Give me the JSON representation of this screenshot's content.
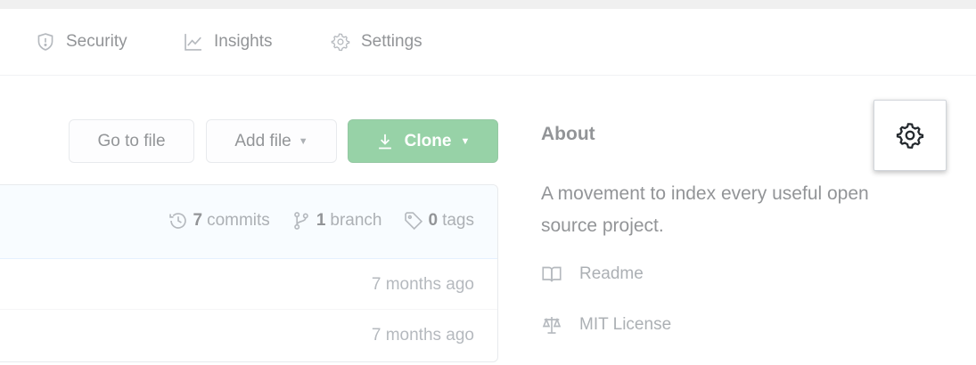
{
  "nav": {
    "tabs": [
      {
        "label": "Security",
        "icon": "shield-icon"
      },
      {
        "label": "Insights",
        "icon": "graph-icon"
      },
      {
        "label": "Settings",
        "icon": "gear-icon"
      }
    ]
  },
  "toolbar": {
    "go_to_file_label": "Go to file",
    "add_file_label": "Add file",
    "clone_label": "Clone",
    "clone_color": "#2ea44f"
  },
  "repo_stats": {
    "commits_count": "7",
    "commits_label": "commits",
    "branches_count": "1",
    "branches_label": "branch",
    "tags_count": "0",
    "tags_label": "tags"
  },
  "file_rows": [
    {
      "age": "7 months ago"
    },
    {
      "age": "7 months ago"
    }
  ],
  "about": {
    "title": "About",
    "description": "A movement to index every useful open source project.",
    "readme_label": "Readme",
    "license_label": "MIT License",
    "edit_icon": "gear-icon"
  }
}
